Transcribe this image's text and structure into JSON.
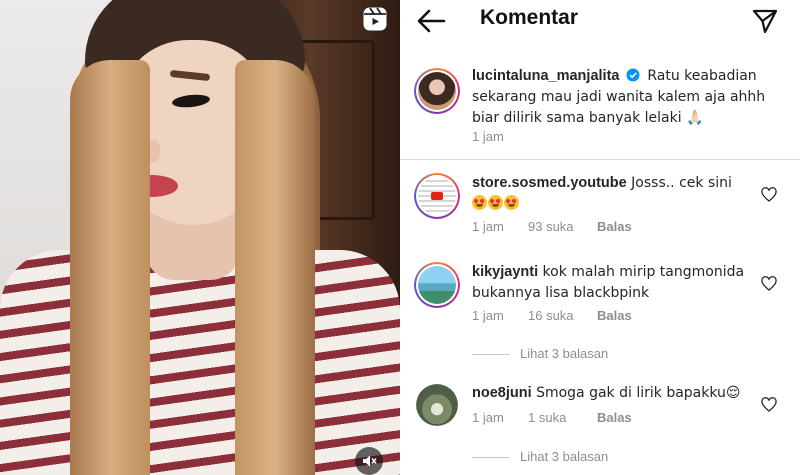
{
  "video": {
    "reels_icon": "reels-icon",
    "mute_icon": "speaker-muted-icon"
  },
  "header": {
    "title": "Komentar",
    "back_icon": "arrow-left-icon",
    "share_icon": "paper-plane-icon"
  },
  "caption": {
    "username": "lucintaluna_manjalita",
    "verified": true,
    "text_line1": "Ratu keabadian",
    "text_line2": "sekarang mau jadi wanita kalem aja ahhh",
    "text_line3": "biar dilirik sama banyak lelaki 🙏🏻",
    "time": "1 jam"
  },
  "comments": [
    {
      "username": "store.sosmed.youtube",
      "text": "Josss.. cek sini",
      "time": "1 jam",
      "likes": "93 suka",
      "reply_label": "Balas"
    },
    {
      "username": "kikyjaynti",
      "text_line1": "kok malah mirip tangmonida",
      "text_line2": "bukannya lisa blackbpink",
      "time": "1 jam",
      "likes": "16 suka",
      "reply_label": "Balas",
      "view_replies": "Lihat 3 balasan"
    },
    {
      "username": "noe8juni",
      "text": "Smoga gak di lirik bapakku😌",
      "time": "1 jam",
      "likes": "1 suka",
      "reply_label": "Balas",
      "view_replies": "Lihat 3 balasan"
    }
  ],
  "colors": {
    "text": "#262626",
    "meta": "#8e8e8e",
    "verified_blue": "#0095f6",
    "divider": "#dbdbdb"
  }
}
